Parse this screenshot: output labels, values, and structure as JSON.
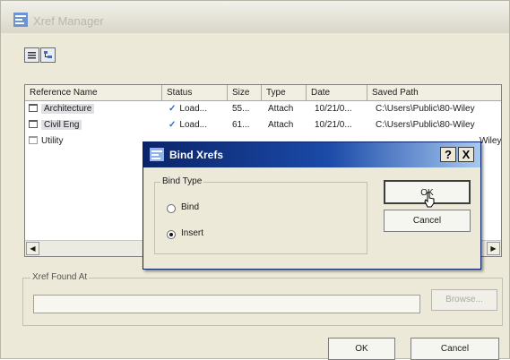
{
  "window": {
    "title": "Xref Manager"
  },
  "view_buttons": [
    {
      "icon": "list-view-icon"
    },
    {
      "icon": "tree-view-icon"
    }
  ],
  "table": {
    "columns": [
      "Reference Name",
      "Status",
      "Size",
      "Type",
      "Date",
      "Saved Path"
    ],
    "rows": [
      {
        "name": "Architecture",
        "status": "Load...",
        "size": "55...",
        "type": "Attach",
        "date": "10/21/0...",
        "path": "C:\\Users\\Public\\80-Wiley"
      },
      {
        "name": "Civil Eng",
        "status": "Load...",
        "size": "61...",
        "type": "Attach",
        "date": "10/21/0...",
        "path": "C:\\Users\\Public\\80-Wiley"
      },
      {
        "name": "Utility",
        "status": "",
        "size": "",
        "type": "",
        "date": "",
        "path": "Wiley"
      }
    ]
  },
  "xref_found": {
    "legend": "Xref Found At",
    "path_value": "",
    "browse_label": "Browse..."
  },
  "footer": {
    "ok_label": "OK",
    "cancel_label": "Cancel"
  },
  "bind_dialog": {
    "title": "Bind Xrefs",
    "help_label": "?",
    "close_label": "X",
    "group_label": "Bind Type",
    "options": [
      {
        "label": "Bind",
        "checked": false
      },
      {
        "label": "Insert",
        "checked": true
      }
    ],
    "ok_label": "OK",
    "cancel_label": "Cancel"
  },
  "colors": {
    "dialog_title_start": "#0a246a",
    "dialog_title_end": "#a6c8f0",
    "status_check": "#3266c8",
    "window_face": "#ece9d8"
  }
}
